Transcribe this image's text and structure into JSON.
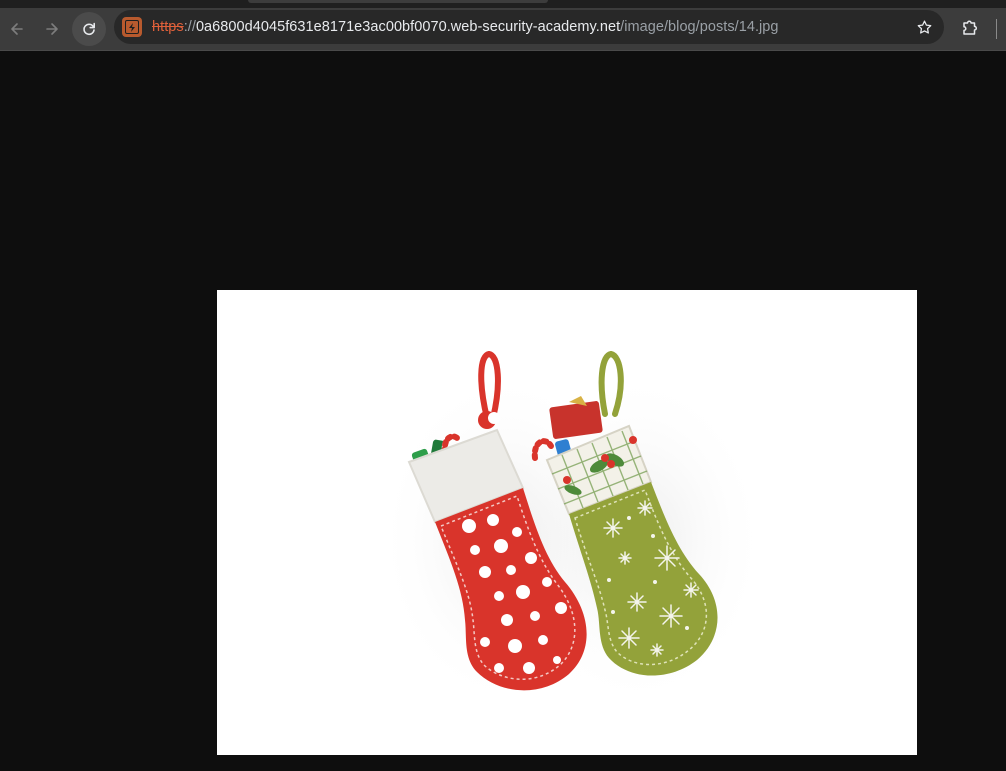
{
  "browser": {
    "url": {
      "scheme": "https",
      "separator": "://",
      "host": "0a6800d4045f631e8171e3ac00bf0070.web-security-academy.net",
      "path": "/image/blog/posts/14.jpg"
    },
    "icons": {
      "back": "arrow-left-icon",
      "forward": "arrow-right-icon",
      "reload": "reload-icon",
      "site": "lightning-bolt-site-icon",
      "bookmark": "star-icon",
      "extensions": "puzzle-piece-icon"
    },
    "colors": {
      "toolbar": "#3c3c3c",
      "omnibox": "#282828",
      "insecure_scheme": "#e0603a",
      "page_background": "#0e0e0e"
    }
  },
  "image": {
    "subject": "two christmas stockings",
    "colors": {
      "red_stocking": "#d9342b",
      "green_stocking": "#93a23a",
      "cuff": "#ecebe7"
    }
  }
}
